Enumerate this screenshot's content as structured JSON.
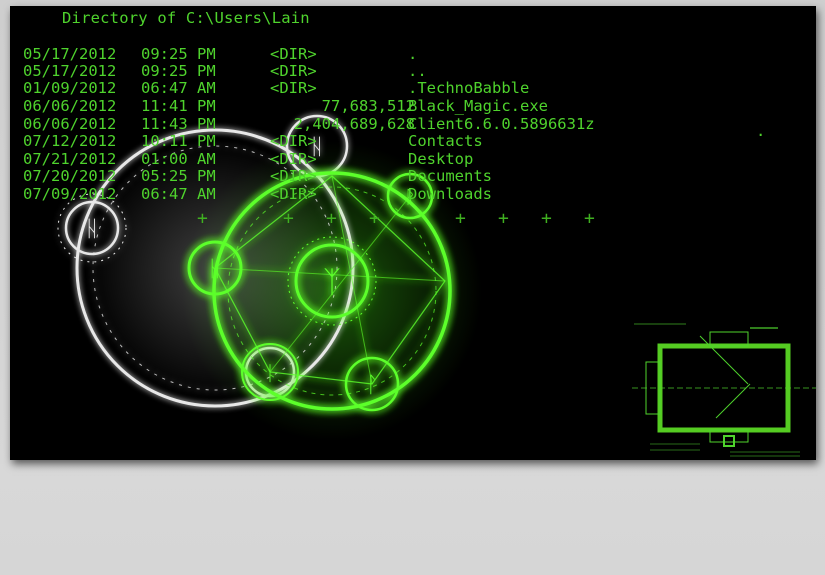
{
  "terminal": {
    "title": "Directory of C:\\Users\\Lain",
    "rows": [
      {
        "date": "05/17/2012",
        "time": "09:25 PM",
        "dir": "<DIR>",
        "size": "",
        "name": "."
      },
      {
        "date": "05/17/2012",
        "time": "09:25 PM",
        "dir": "<DIR>",
        "size": "",
        "name": ".."
      },
      {
        "date": "01/09/2012",
        "time": "06:47 AM",
        "dir": "<DIR>",
        "size": "",
        "name": ".TechnoBabble"
      },
      {
        "date": "06/06/2012",
        "time": "11:41 PM",
        "dir": "",
        "size": "77,683,512",
        "name": "Black_Magic.exe"
      },
      {
        "date": "06/06/2012",
        "time": "11:43 PM",
        "dir": "",
        "size": "2,404,689,628",
        "name": "Client6.6.0.5896631z"
      },
      {
        "date": "07/12/2012",
        "time": "10:11 PM",
        "dir": "<DIR>",
        "size": "",
        "name": "Contacts"
      },
      {
        "date": "07/21/2012",
        "time": "01:00 AM",
        "dir": "<DIR>",
        "size": "",
        "name": "Desktop"
      },
      {
        "date": "07/20/2012",
        "time": "05:25 PM",
        "dir": "<DIR>",
        "size": "",
        "name": "Documents"
      },
      {
        "date": "07/09/2012",
        "time": "06:47 AM",
        "dir": "<DIR>",
        "size": "",
        "name": "Downloads"
      }
    ],
    "stray_char": "."
  },
  "colors": {
    "terminal_green": "#4fd32d",
    "glow_green": "#5cff2a",
    "ring_white": "#e8e8e8",
    "background": "#000000"
  },
  "decorations": {
    "magic_circle": "magic-circle-icon",
    "blueprint": "blueprint-diagram-icon",
    "crosshair": "crosshair-icon"
  }
}
